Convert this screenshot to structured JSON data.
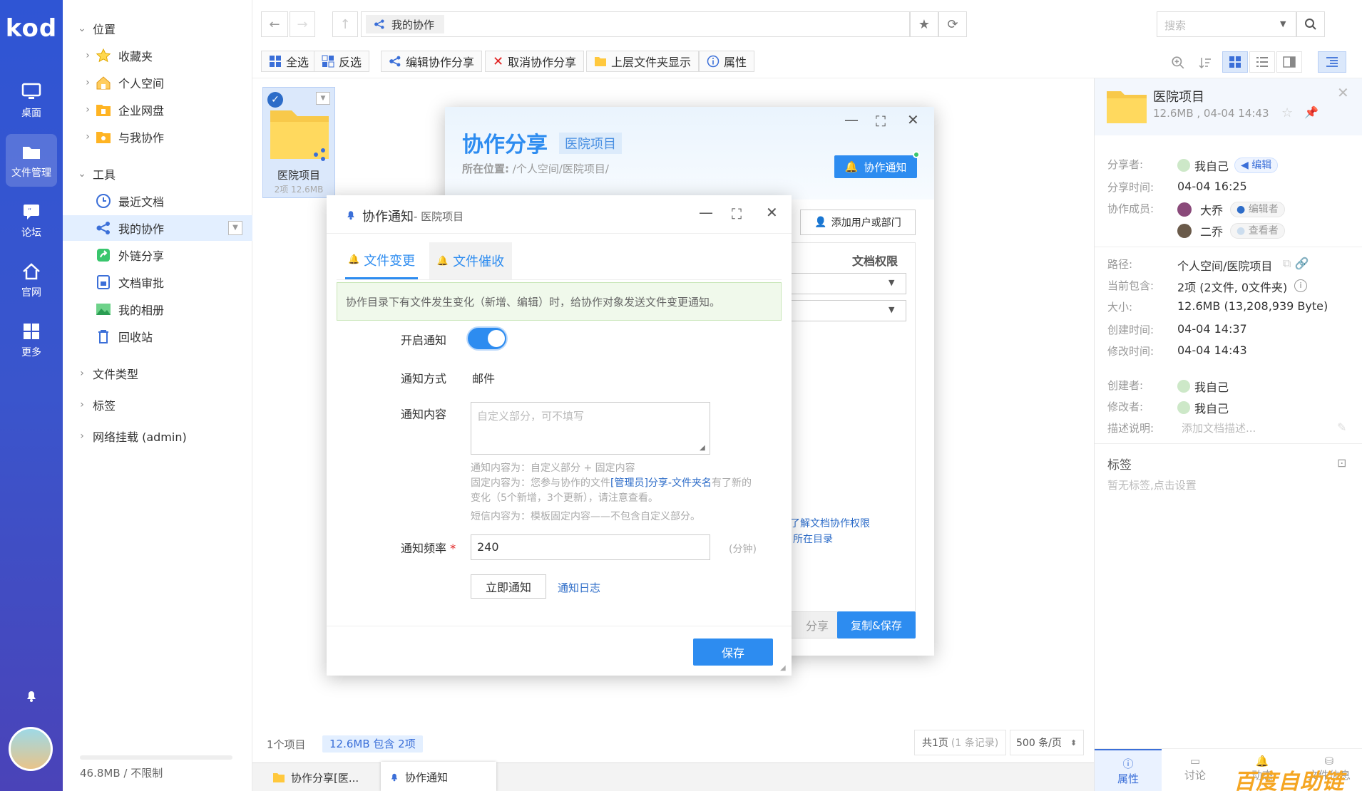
{
  "app": {
    "logo": "kod"
  },
  "rail": {
    "items": [
      {
        "label": "桌面",
        "icon": "desktop-icon"
      },
      {
        "label": "文件管理",
        "icon": "folder-icon",
        "active": true
      },
      {
        "label": "论坛",
        "icon": "forum-icon"
      },
      {
        "label": "官网",
        "icon": "home-icon"
      },
      {
        "label": "更多",
        "icon": "grid-icon"
      }
    ]
  },
  "tree": {
    "sections": {
      "location": "位置",
      "tools": "工具",
      "filetype": "文件类型",
      "tags": "标签",
      "mount": "网络挂载 (admin)"
    },
    "location_items": [
      "收藏夹",
      "个人空间",
      "企业网盘",
      "与我协作"
    ],
    "tool_items": [
      "最近文档",
      "我的协作",
      "外链分享",
      "文档审批",
      "我的相册",
      "回收站"
    ],
    "storage": "46.8MB / 不限制"
  },
  "path": {
    "current": "我的协作"
  },
  "search": {
    "placeholder": "搜索"
  },
  "toolbar": {
    "select_all": "全选",
    "invert": "反选",
    "edit_share": "编辑协作分享",
    "cancel_share": "取消协作分享",
    "parent_folder": "上层文件夹显示",
    "properties": "属性"
  },
  "file": {
    "name": "医院项目",
    "meta": "2项 12.6MB"
  },
  "statusbar": {
    "count": "1个项目",
    "selection": "12.6MB 包含 2项",
    "pages": "共1页",
    "records": "(1 条记录)",
    "per_page": "500 条/页"
  },
  "taskbar": {
    "tab1": "协作分享[医...",
    "tab2": "协作通知"
  },
  "share_dialog": {
    "title": "协作分享",
    "title_tag": "医院项目",
    "location_label": "所在位置:",
    "location": "/个人空间/医院项目/",
    "notify_btn": "协作通知",
    "add_user": "添加用户或部门",
    "col_perm": "文档权限",
    "link1": "了解文档协作权限",
    "link2": "所在目录",
    "btn_share": "分享",
    "btn_copy_save": "复制&保存"
  },
  "notify_dialog": {
    "title": "协作通知",
    "subtitle": " - 医院项目",
    "tab1": "文件变更",
    "tab2": "文件催收",
    "banner": "协作目录下有文件发生变化（新增、编辑）时，给协作对象发送文件变更通知。",
    "enable_label": "开启通知",
    "enabled": true,
    "method_label": "通知方式",
    "method_value": "邮件",
    "content_label": "通知内容",
    "content_placeholder": "自定义部分，可不填写",
    "help1": "通知内容为：自定义部分 + 固定内容",
    "help2a": "固定内容为：您参与协作的文件",
    "help2b": "[管理员]分享-文件夹名",
    "help2c": "有了新的",
    "help3": "变化（5个新增，3个更新），请注意查看。",
    "help4": "短信内容为：模板固定内容——不包含自定义部分。",
    "freq_label": "通知频率",
    "freq_value": "240",
    "freq_unit": "(分钟)",
    "btn_now": "立即通知",
    "log_link": "通知日志",
    "btn_save": "保存"
  },
  "info_panel": {
    "name": "医院项目",
    "meta": "12.6MB , 04-04 14:43",
    "rows": [
      {
        "label": "分享者:",
        "value": "我自己",
        "tag": "编辑"
      },
      {
        "label": "分享时间:",
        "value": "04-04 16:25"
      },
      {
        "label": "协作成员:",
        "value": "大乔",
        "tag": "编辑者"
      },
      {
        "label": "",
        "value": "二乔",
        "tag": "查看者"
      },
      {
        "label": "路径:",
        "value": "个人空间/医院项目"
      },
      {
        "label": "当前包含:",
        "value": "2项 (2文件, 0文件夹)"
      },
      {
        "label": "大小:",
        "value": "12.6MB (13,208,939 Byte)"
      },
      {
        "label": "创建时间:",
        "value": "04-04 14:37"
      },
      {
        "label": "修改时间:",
        "value": "04-04 14:43"
      },
      {
        "label": "创建者:",
        "value": "我自己"
      },
      {
        "label": "修改者:",
        "value": "我自己"
      },
      {
        "label": "描述说明:",
        "value": "添加文档描述..."
      }
    ],
    "tags_title": "标签",
    "tags_empty": "暂无标签,点击设置",
    "tabs": [
      "属性",
      "讨论",
      "动态",
      "文件信息"
    ]
  },
  "watermark": "百度自助链",
  "colors": {
    "brand": "#2f55d4",
    "accent": "#2d8cf0",
    "selected_bg": "#e3efff"
  }
}
